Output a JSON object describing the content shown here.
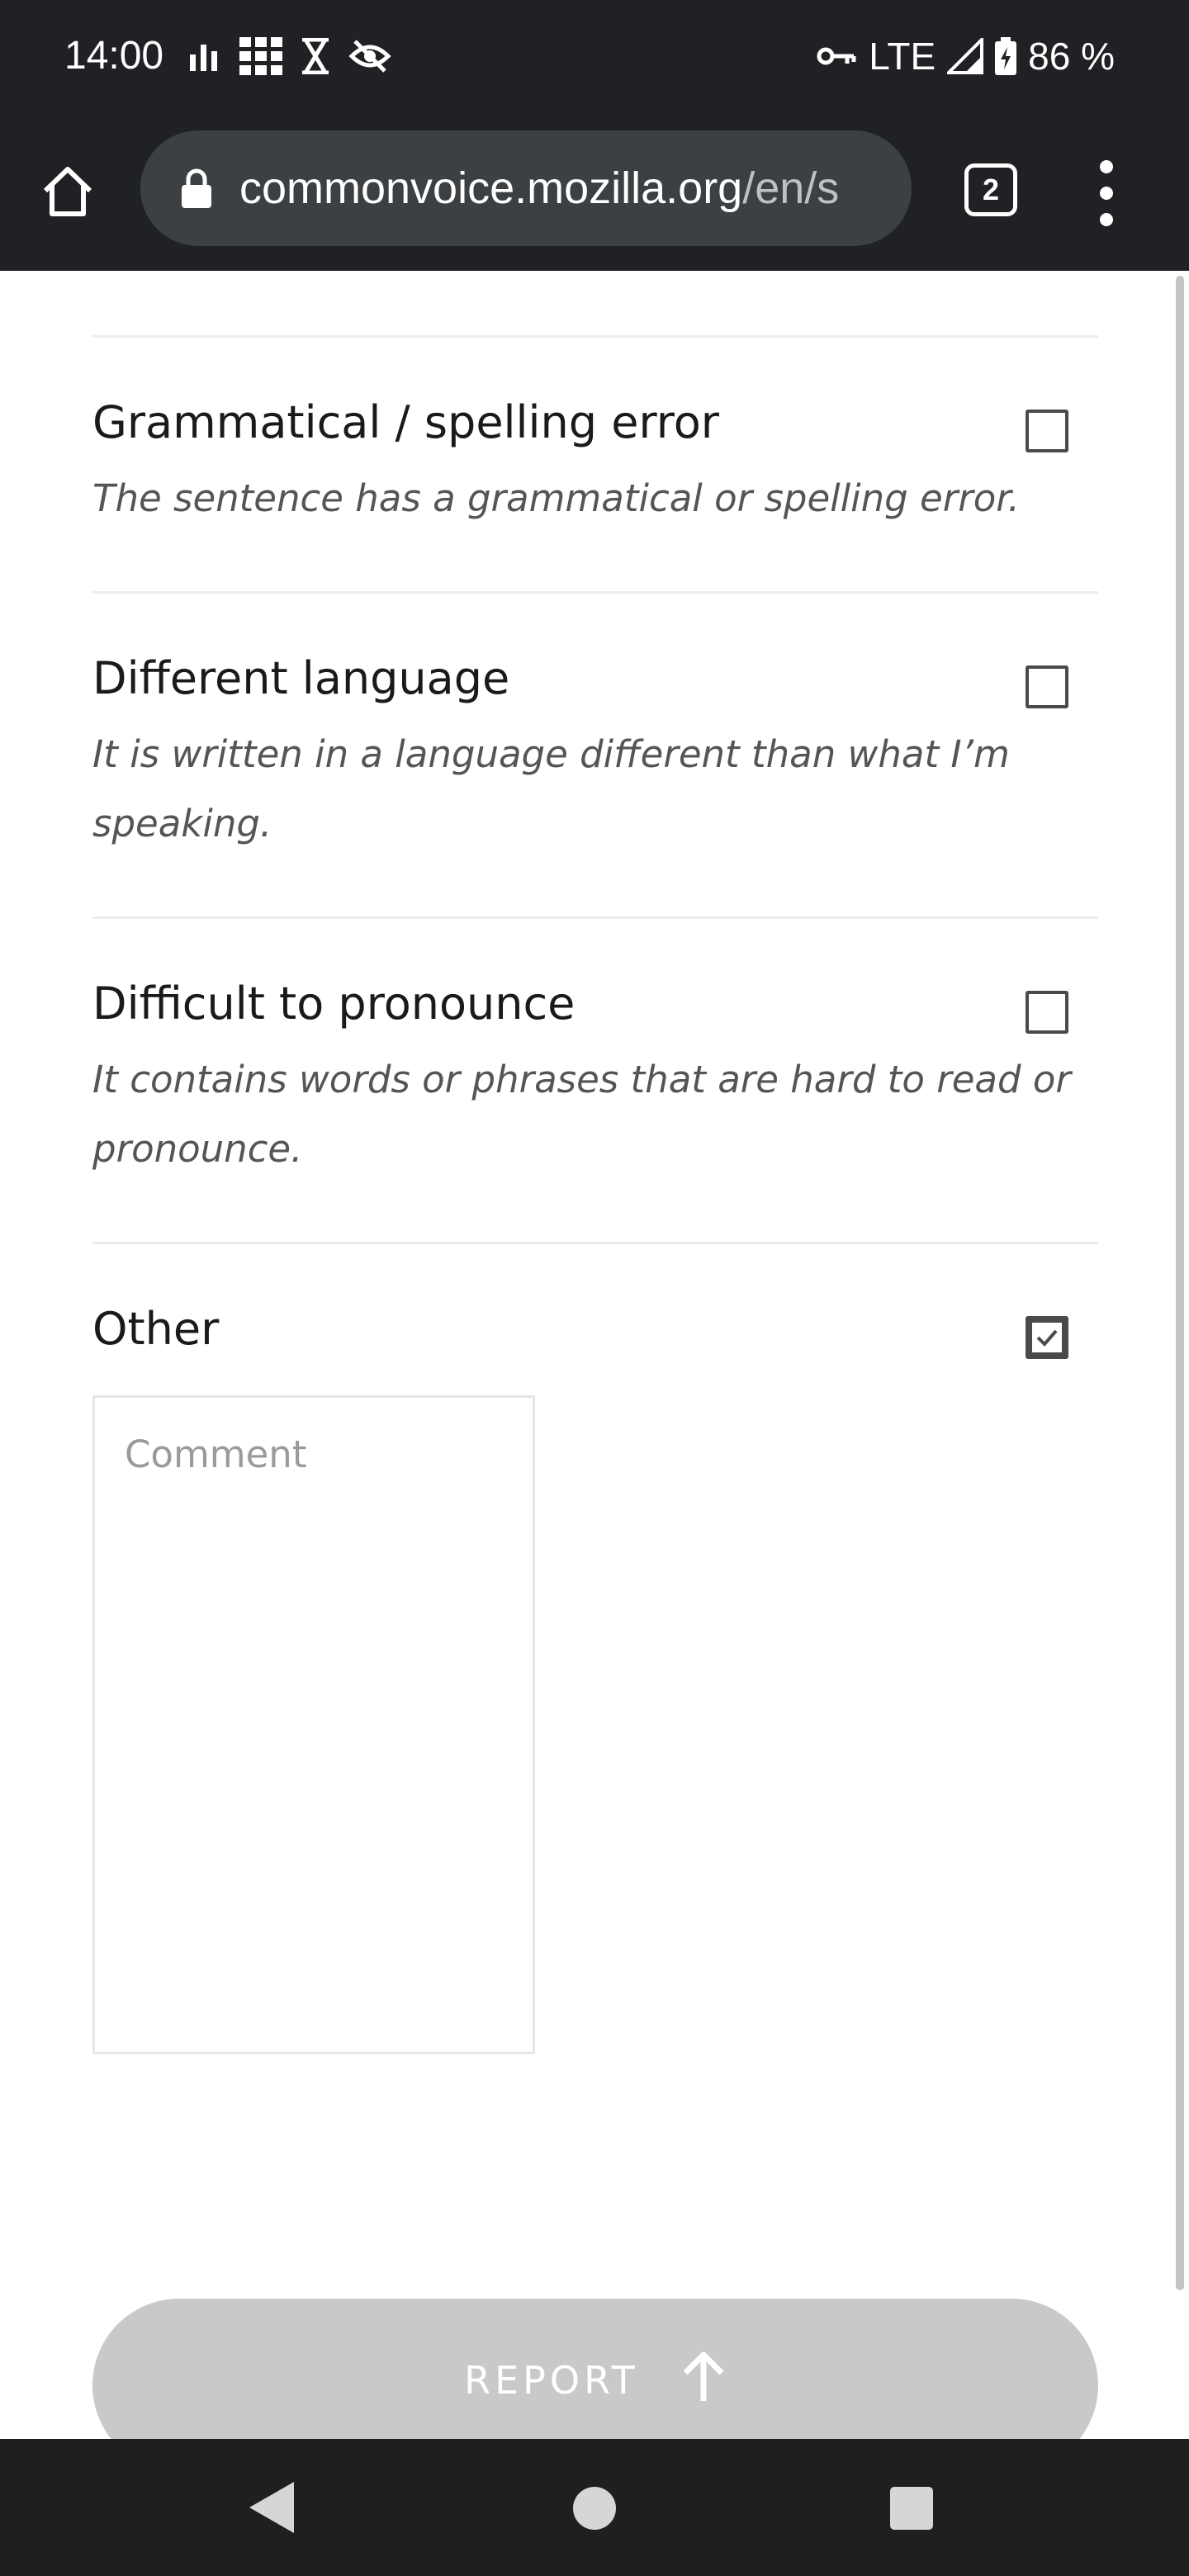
{
  "status_bar": {
    "time": "14:00",
    "network": "LTE",
    "battery": "86 %"
  },
  "browser": {
    "url_host": "commonvoice.mozilla.org",
    "url_path": "/en/s",
    "tab_count": "2"
  },
  "report_options": [
    {
      "title": "Grammatical / spelling error",
      "description": "The sentence has a grammatical or spelling error.",
      "checked": false
    },
    {
      "title": "Different language",
      "description": "It is written in a language different than what I’m speaking.",
      "checked": false
    },
    {
      "title": "Difficult to pronounce",
      "description": "It contains words or phrases that are hard to read or pronounce.",
      "checked": false
    },
    {
      "title": "Other",
      "checked": true
    }
  ],
  "comment": {
    "placeholder": "Comment",
    "value": ""
  },
  "report_button": {
    "label": "REPORT",
    "enabled": false
  },
  "colors": {
    "chrome_dark": "#202124",
    "url_bar": "#3c4043",
    "button_disabled": "#c9c9c9",
    "checkbox_border": "#4a4a4a"
  }
}
